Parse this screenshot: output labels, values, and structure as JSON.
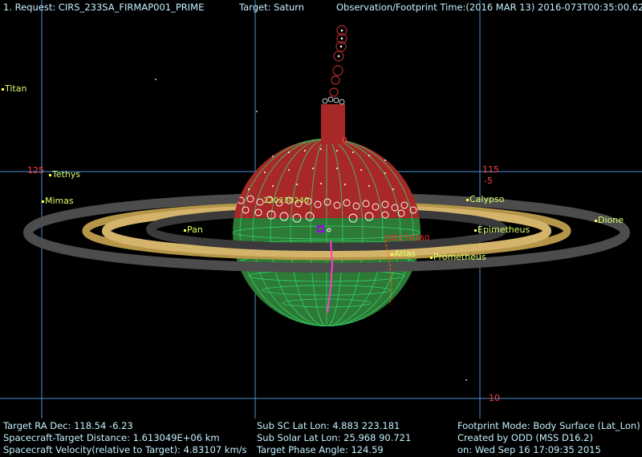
{
  "header": {
    "request": "1. Request: CIRS_233SA_FIRMAP001_PRIME",
    "target": "Target: Saturn",
    "time": "Observation/Footprint Time:(2016 MAR 13) 2016-073T00:35:00.62"
  },
  "moons": {
    "titan": "Titan",
    "tethys": "Tethys",
    "mimas": "Mimas",
    "pan": "Pan",
    "calypso": "Calypso",
    "epimetheus": "Epimetheus",
    "dione": "Dione",
    "atlas": "Atlas",
    "prometheus": "Prometheus"
  },
  "grid_labels": {
    "ra_left": "125",
    "ra_right": "115",
    "dec_upper": "-5",
    "dec_lower": "-10",
    "lat_top": "0",
    "lon_label": "180170160",
    "lon_left": "220230240"
  },
  "footer": {
    "ra_dec": "Target RA Dec: 118.54   -6.23",
    "distance": "Spacecraft-Target Distance: 1.613049E+06 km",
    "velocity": "Spacecraft Velocity(relative to Target): 4.83107 km/s",
    "sub_sc": "Sub SC Lat Lon:  4.883  223.181",
    "sub_solar": "Sub Solar Lat Lon: 25.968   90.721",
    "phase": "Target Phase Angle: 124.59",
    "footprint_mode": "Footprint Mode: Body Surface (Lat_Lon)",
    "created_by": "Created by ODD (MSS D16.2)",
    "created_on": "on: Wed Sep 16 17:09:35 2015"
  },
  "colors": {
    "background": "#000000",
    "grid": "#5aa0e0",
    "planet_lit": "#2f8a3a",
    "planet_footprint": "#b02a2a",
    "rings": "#c8a860",
    "moon_label": "#d8ff6a",
    "header_text": "#c4f2ff"
  }
}
